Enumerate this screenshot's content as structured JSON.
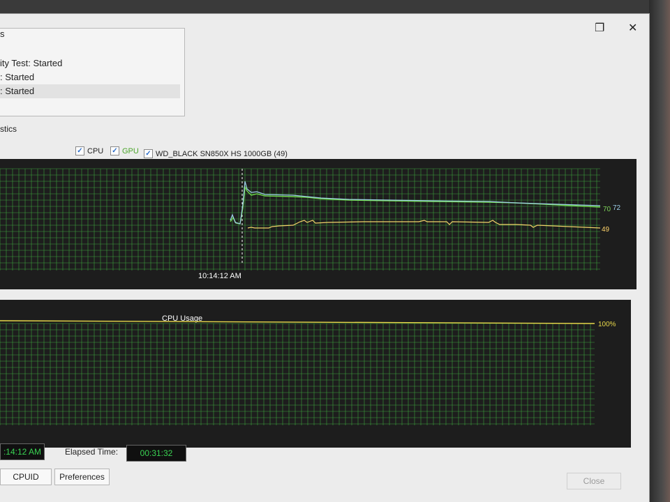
{
  "window": {
    "restore_icon": "❐",
    "close_icon": "✕"
  },
  "log": {
    "top_fragment": "s",
    "lines": [
      "ity Test: Started",
      ": Started",
      ": Started"
    ]
  },
  "tab_label": "stics",
  "temp_chart": {
    "legend": [
      {
        "label": "CPU",
        "color": "#ffffff"
      },
      {
        "label": "GPU",
        "color": "#9be05a"
      },
      {
        "label": "WD_BLACK SN850X HS 1000GB (49)",
        "color": "#ffe27a"
      }
    ],
    "time_label": "10:14:12 AM",
    "right_labels": [
      {
        "text": "70",
        "color": "#7fd45a"
      },
      {
        "text": "72",
        "color": "#9ecfe8"
      },
      {
        "text": "49",
        "color": "#ffd46a"
      }
    ],
    "colors": {
      "cpu": "#9ecfe8",
      "gpu": "#6fd84a",
      "ssd": "#f2d26a",
      "grid": "#3fa43f"
    }
  },
  "usage_chart": {
    "title": "CPU Usage",
    "value_label": "100%",
    "colors": {
      "line": "#e8d84a",
      "grid": "#3fa43f"
    }
  },
  "status": {
    "start_time_fragment": ":14:12 AM",
    "elapsed_label": "Elapsed Time:",
    "elapsed_value": "00:31:32"
  },
  "buttons": {
    "cpuid": "CPUID",
    "preferences": "Preferences",
    "close": "Close"
  }
}
